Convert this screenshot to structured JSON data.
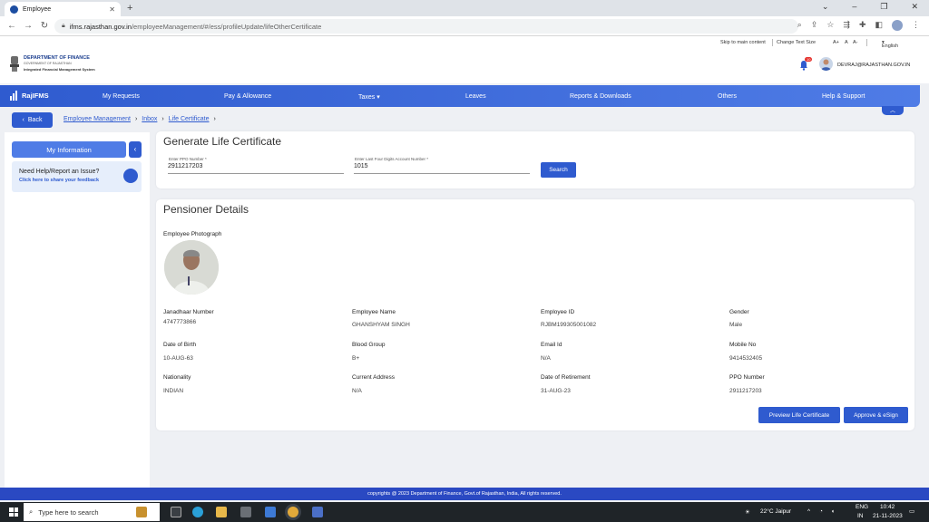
{
  "browser": {
    "tab_title": "Employee",
    "url_host": "ifms.rajasthan.gov.in",
    "url_path": "/employeeManagement/#/ess/profileUpdate/lifeOtherCertificate"
  },
  "utility": {
    "skip": "Skip to main content",
    "text_size": "Change Text Size",
    "a_plus": "A+",
    "a": "A",
    "a_minus": "A-",
    "language": "English"
  },
  "header": {
    "org_name": "DEPARTMENT OF FINANCE",
    "org_sub": "GOVERNMENT OF RAJASTHAN",
    "system_name": "Integrated Financial Management System",
    "notif_count": "10",
    "user_email": "DEVRAJ@RAJASTHAN.GOV.IN"
  },
  "nav": {
    "brand": "RajIFMS",
    "items": [
      "My Requests",
      "Pay & Allowance",
      "Taxes",
      "Leaves",
      "Reports & Downloads",
      "Others",
      "Help & Support"
    ]
  },
  "breadcrumb": {
    "back": "Back",
    "items": [
      "Employee Management",
      "Inbox",
      "Life Certificate"
    ]
  },
  "sidebar": {
    "my_info": "My Information",
    "help_title": "Need Help/Report an Issue?",
    "help_link": "Click here to share your feedback"
  },
  "generate": {
    "title": "Generate Life Certificate",
    "ppo_label": "Enter PPO Number *",
    "ppo_value": "2911217203",
    "acct_label": "Enter Last Four Digits Account Number *",
    "acct_value": "1015",
    "search": "Search"
  },
  "pensioner": {
    "title": "Pensioner Details",
    "photo_label": "Employee Photograph",
    "fields": [
      {
        "label": "Janadhaar Number",
        "value": "4747773866"
      },
      {
        "label": "Employee Name",
        "value": "GHANSHYAM SINGH"
      },
      {
        "label": "Employee ID",
        "value": "RJBM199305001082"
      },
      {
        "label": "Gender",
        "value": "Male"
      },
      {
        "label": "Date of Birth",
        "value": "10-AUG-63"
      },
      {
        "label": "Blood Group",
        "value": "B+"
      },
      {
        "label": "Email Id",
        "value": "N/A"
      },
      {
        "label": "Mobile No",
        "value": "9414532405"
      },
      {
        "label": "Nationality",
        "value": "INDIAN"
      },
      {
        "label": "Current Address",
        "value": "N/A"
      },
      {
        "label": "Date of Retirement",
        "value": "31-AUG-23"
      },
      {
        "label": "PPO Number",
        "value": "2911217203"
      }
    ],
    "preview_btn": "Preview Life Certificate",
    "approve_btn": "Approve & eSign"
  },
  "footer": {
    "text": "copyrights @ 2023 Department of Finance, Govt.of Rajasthan, India, All rights reserved."
  },
  "taskbar": {
    "search_placeholder": "Type here to search",
    "weather": "22°C  Jaipur",
    "lang1": "ENG",
    "lang2": "IN",
    "time": "10:42",
    "date": "21-11-2023"
  },
  "colors": {
    "primary": "#2f5bcf",
    "footer": "#2a49c2",
    "badge": "#e5322d"
  }
}
